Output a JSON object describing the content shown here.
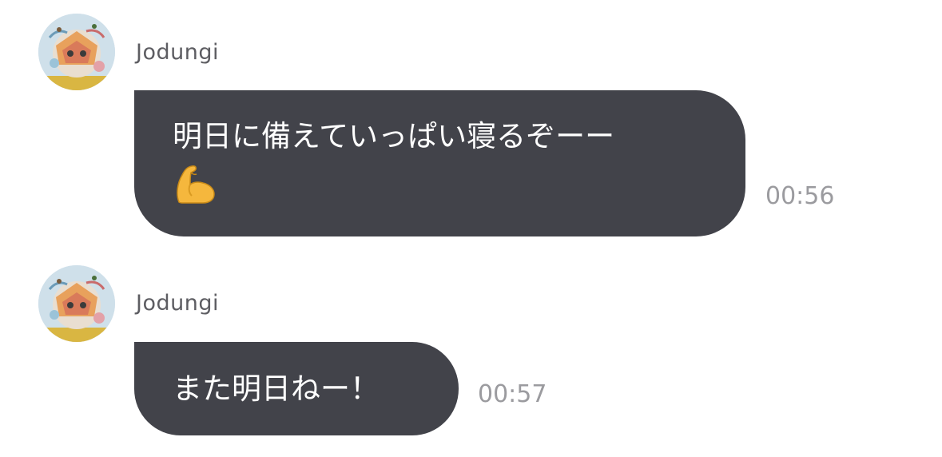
{
  "messages": [
    {
      "sender": "Jodungi",
      "text": "明日に備えていっぱい寝るぞーー",
      "emoji": "flexed-biceps-icon",
      "time": "00:56"
    },
    {
      "sender": "Jodungi",
      "text": "また明日ねー！",
      "time": "00:57"
    }
  ],
  "colors": {
    "bubble": "#42434a",
    "bubble_text": "#ffffff",
    "sender": "#5d5d62",
    "time": "#9b9b9f",
    "background": "#ffffff"
  }
}
